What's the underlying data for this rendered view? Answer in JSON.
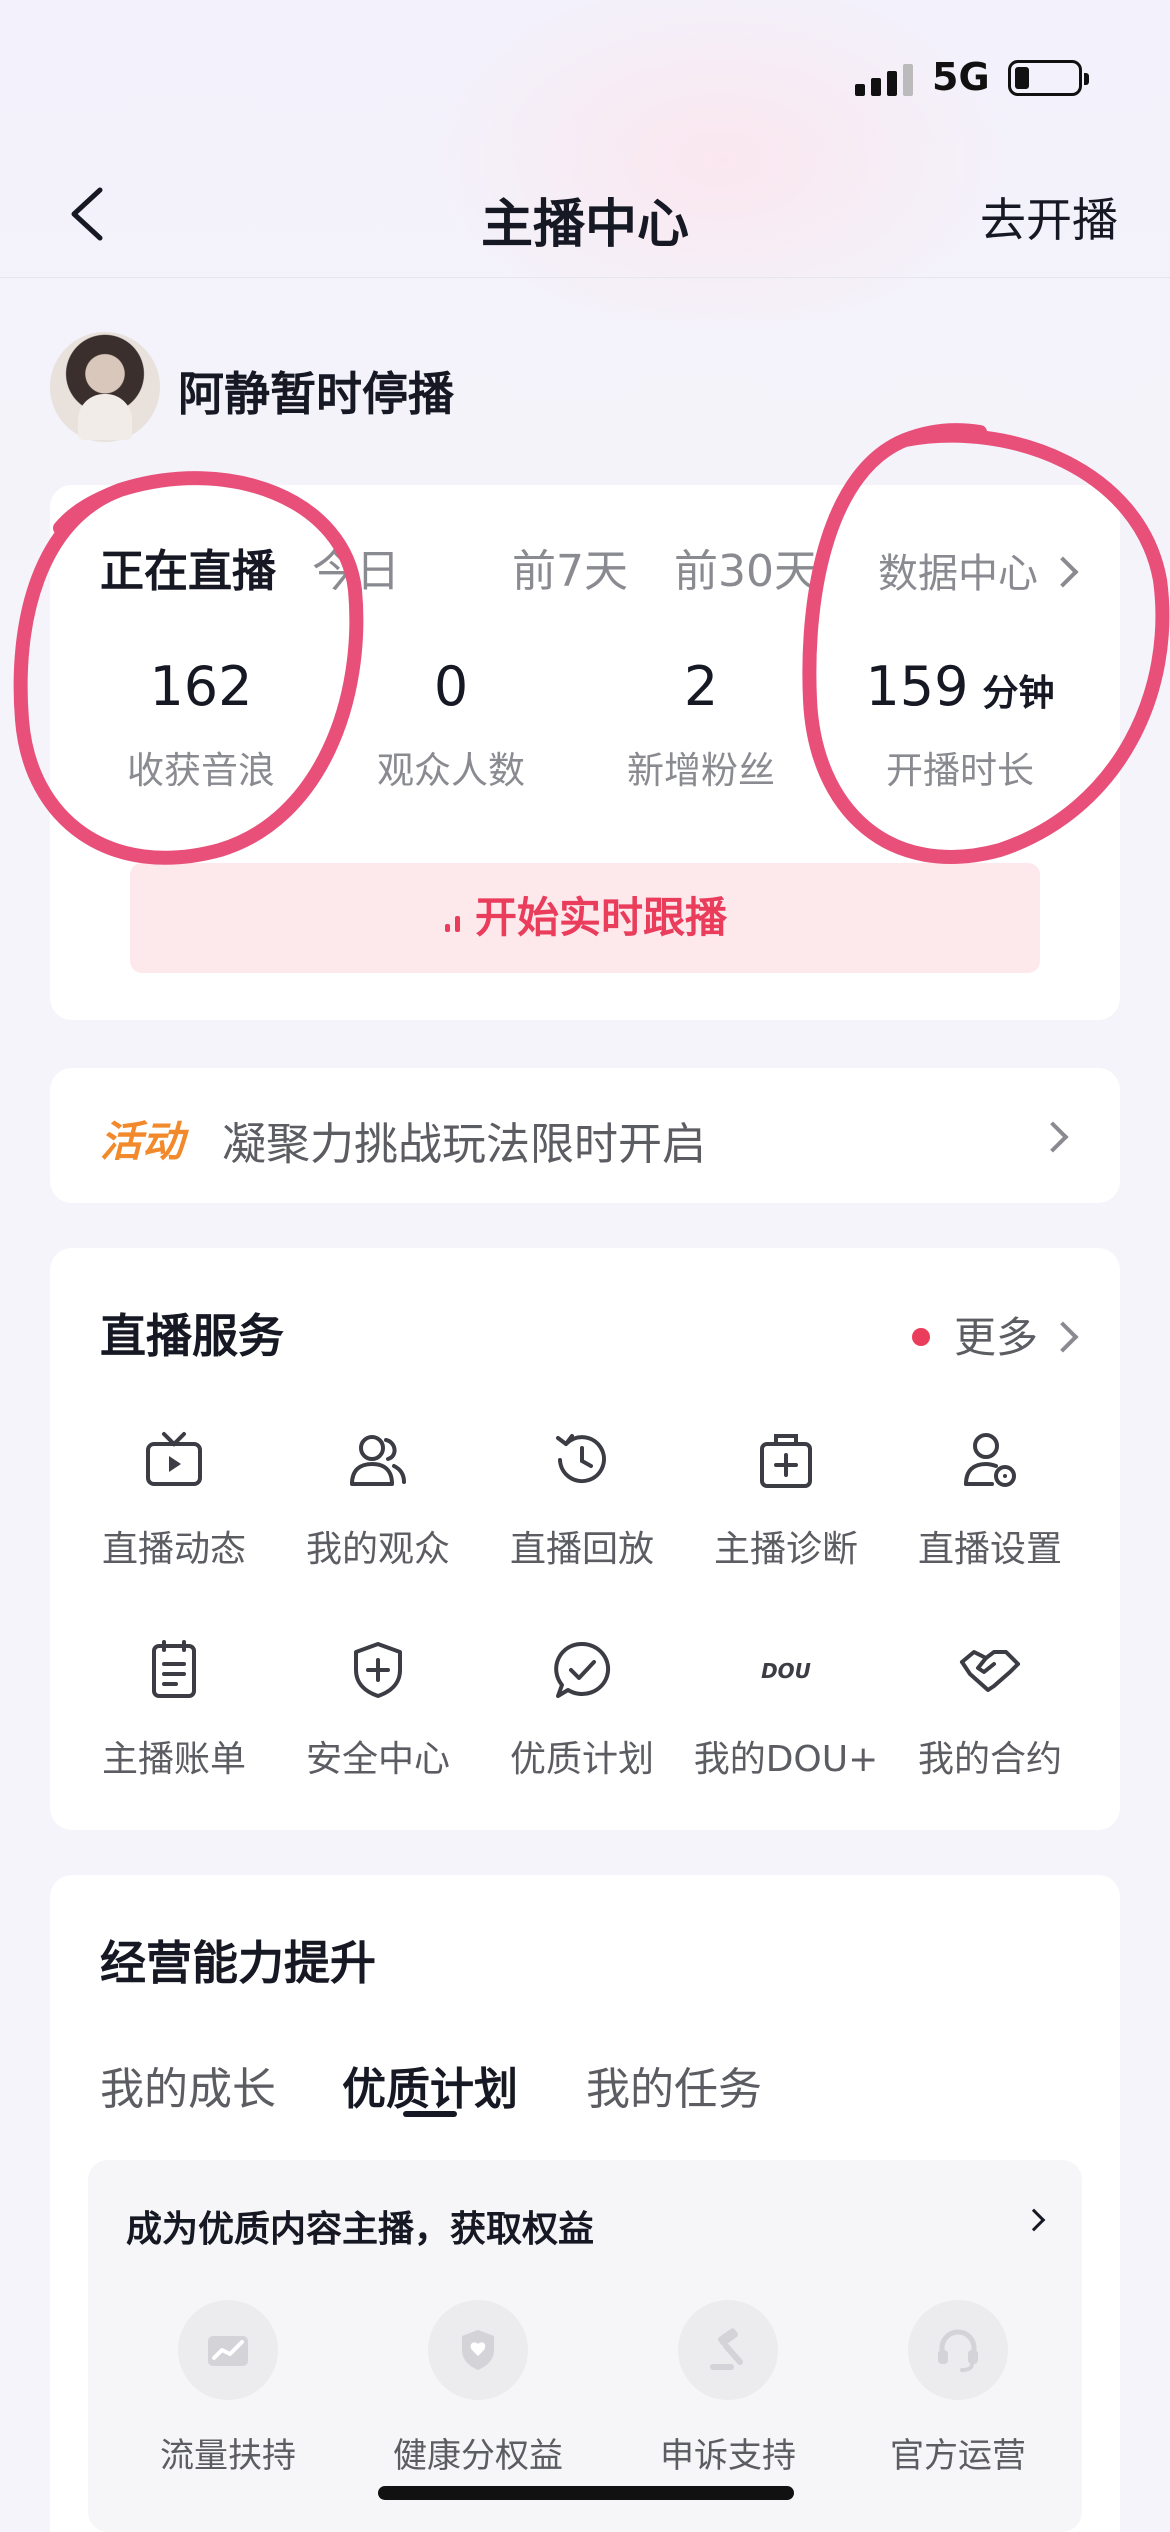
{
  "status_bar": {
    "network": "5G"
  },
  "nav": {
    "title": "主播中心",
    "action": "去开播"
  },
  "profile": {
    "name": "阿静暂时停播"
  },
  "stats": {
    "tabs": [
      "正在直播",
      "今日",
      "前7天",
      "前30天"
    ],
    "active_tab": "正在直播",
    "data_center": "数据中心",
    "metrics": [
      {
        "value": "162",
        "unit": "",
        "label": "收获音浪"
      },
      {
        "value": "0",
        "unit": "",
        "label": "观众人数"
      },
      {
        "value": "2",
        "unit": "",
        "label": "新增粉丝"
      },
      {
        "value": "159",
        "unit": "分钟",
        "label": "开播时长"
      }
    ],
    "follow_button": "开始实时跟播"
  },
  "activity": {
    "tag": "活动",
    "text": "凝聚力挑战玩法限时开启"
  },
  "services": {
    "title": "直播服务",
    "more": "更多",
    "items": [
      {
        "label": "直播动态",
        "icon": "tv-icon"
      },
      {
        "label": "我的观众",
        "icon": "audience-icon"
      },
      {
        "label": "直播回放",
        "icon": "replay-clock-icon"
      },
      {
        "label": "主播诊断",
        "icon": "medical-kit-icon"
      },
      {
        "label": "直播设置",
        "icon": "user-settings-icon"
      },
      {
        "label": "主播账单",
        "icon": "bill-icon"
      },
      {
        "label": "安全中心",
        "icon": "shield-plus-icon"
      },
      {
        "label": "优质计划",
        "icon": "chat-check-icon"
      },
      {
        "label": "我的DOU+",
        "icon": "dou-plus-icon",
        "icon_text": "DOU"
      },
      {
        "label": "我的合约",
        "icon": "handshake-icon"
      }
    ]
  },
  "growth": {
    "title": "经营能力提升",
    "tabs": [
      "我的成长",
      "优质计划",
      "我的任务"
    ],
    "active_tab": "优质计划",
    "benefit_title": "成为优质内容主播，获取权益",
    "benefits": [
      {
        "label": "流量扶持",
        "icon": "traffic-chart-icon"
      },
      {
        "label": "健康分权益",
        "icon": "health-shield-icon"
      },
      {
        "label": "申诉支持",
        "icon": "gavel-icon"
      },
      {
        "label": "官方运营",
        "icon": "headset-icon"
      }
    ]
  },
  "colors": {
    "accent": "#ea3d5c",
    "activity": "#f28a2c",
    "annotation": "#e8507a"
  }
}
